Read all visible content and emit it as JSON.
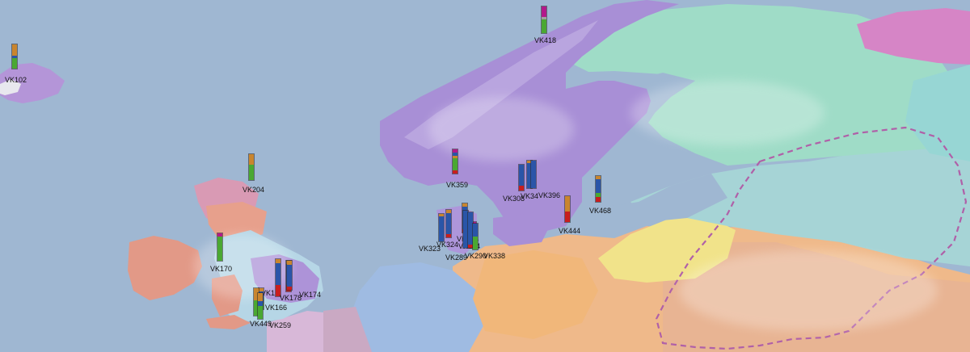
{
  "map": {
    "palette": {
      "sea": "#9fb7d2",
      "scandinavia": "#a98fd8",
      "finland": "#9fdcc8",
      "baltic_east": "#a7d5d8",
      "russia_north": "#c07ac9",
      "central_europe": "#f2bd86",
      "ireland": "#e49a88",
      "britain": "#b7d6e6",
      "low_countries": "#9fb7e0",
      "yellow_region": "#f2e58b",
      "east_orange": "#e8b38f",
      "dashed_border": "#b060a8"
    },
    "legend_colors": {
      "orange": "#c9852e",
      "blue": "#2a55a8",
      "green": "#4aa832",
      "red": "#c81e1e",
      "magenta": "#b2188a",
      "gray": "#a0a0a0"
    },
    "sites": [
      {
        "id": "VK102",
        "segments": [
          [
            "orange",
            0.45
          ],
          [
            "blue",
            0.1
          ],
          [
            "green",
            0.45
          ]
        ]
      },
      {
        "id": "VK418",
        "segments": [
          [
            "magenta",
            0.4
          ],
          [
            "gray",
            0.1
          ],
          [
            "green",
            0.5
          ]
        ]
      },
      {
        "id": "VK204",
        "segments": [
          [
            "orange",
            0.42
          ],
          [
            "green",
            0.58
          ]
        ]
      },
      {
        "id": "VK359",
        "segments": [
          [
            "magenta",
            0.12
          ],
          [
            "blue",
            0.15
          ],
          [
            "orange",
            0.1
          ],
          [
            "green",
            0.5
          ],
          [
            "red",
            0.13
          ]
        ]
      },
      {
        "id": "VK308",
        "segments": [
          [
            "blue",
            0.8
          ],
          [
            "red",
            0.2
          ]
        ]
      },
      {
        "id": "VK34",
        "segments": [
          [
            "orange",
            0.08
          ],
          [
            "blue",
            0.92
          ]
        ]
      },
      {
        "id": "VK396",
        "segments": [
          [
            "blue",
            1.0
          ]
        ]
      },
      {
        "id": "VK468",
        "segments": [
          [
            "orange",
            0.12
          ],
          [
            "blue",
            0.55
          ],
          [
            "green",
            0.15
          ],
          [
            "red",
            0.18
          ]
        ]
      },
      {
        "id": "VK444",
        "segments": [
          [
            "orange",
            0.6
          ],
          [
            "red",
            0.4
          ]
        ]
      },
      {
        "id": "VK323",
        "segments": [
          [
            "orange",
            0.1
          ],
          [
            "blue",
            0.9
          ]
        ]
      },
      {
        "id": "VK324",
        "segments": [
          [
            "orange",
            0.12
          ],
          [
            "blue",
            0.75
          ],
          [
            "red",
            0.13
          ]
        ]
      },
      {
        "id": "VK354",
        "segments": [
          [
            "orange",
            0.1
          ],
          [
            "blue",
            0.8
          ],
          [
            "red",
            0.1
          ]
        ]
      },
      {
        "id": "VK134",
        "segments": [
          [
            "magenta",
            0.5
          ],
          [
            "blue",
            0.2
          ],
          [
            "green",
            0.3
          ]
        ]
      },
      {
        "id": "VK289",
        "segments": [
          [
            "blue",
            1.0
          ]
        ]
      },
      {
        "id": "VK290",
        "segments": [
          [
            "blue",
            0.9
          ],
          [
            "red",
            0.1
          ]
        ]
      },
      {
        "id": "VK338",
        "segments": [
          [
            "blue",
            0.5
          ],
          [
            "green",
            0.5
          ]
        ]
      },
      {
        "id": "VK170",
        "segments": [
          [
            "magenta",
            0.12
          ],
          [
            "green",
            0.88
          ]
        ]
      },
      {
        "id": "VK1",
        "segments": [
          [
            "orange",
            0.1
          ],
          [
            "blue",
            0.6
          ],
          [
            "red",
            0.3
          ]
        ]
      },
      {
        "id": "VK178",
        "segments": [
          [
            "orange",
            0.1
          ],
          [
            "blue",
            0.7
          ],
          [
            "red",
            0.2
          ]
        ]
      },
      {
        "id": "VK174",
        "segments": [
          [
            "orange",
            0.15
          ],
          [
            "blue",
            0.75
          ],
          [
            "red",
            0.1
          ]
        ]
      },
      {
        "id": "VK166",
        "segments": [
          [
            "orange",
            0.15
          ],
          [
            "blue",
            0.55
          ],
          [
            "green",
            0.3
          ]
        ]
      },
      {
        "id": "VK449",
        "segments": [
          [
            "orange",
            0.45
          ],
          [
            "green",
            0.55
          ]
        ]
      },
      {
        "id": "VK259",
        "segments": [
          [
            "orange",
            0.3
          ],
          [
            "blue",
            0.2
          ],
          [
            "green",
            0.5
          ]
        ]
      }
    ]
  }
}
